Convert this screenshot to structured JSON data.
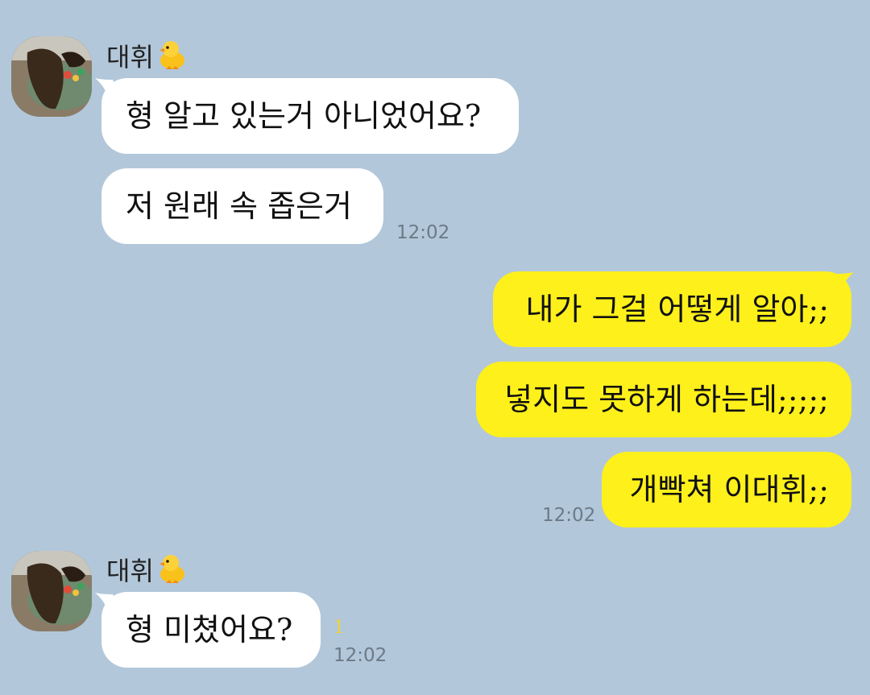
{
  "chat": {
    "groups": [
      {
        "sender_name": "대휘",
        "sender_emoji": "baby-chick-icon",
        "messages": [
          {
            "text": "형 알고 있는거 아니었어요?"
          },
          {
            "text": "저 원래 속 좁은거",
            "time": "12:02"
          }
        ]
      },
      {
        "outgoing": true,
        "messages": [
          {
            "text": "내가 그걸 어떻게 알아;;"
          },
          {
            "text": "넣지도 못하게 하는데;;;;;"
          },
          {
            "text": "개빡쳐 이대휘;;",
            "time": "12:02"
          }
        ]
      },
      {
        "sender_name": "대휘",
        "sender_emoji": "baby-chick-icon",
        "messages": [
          {
            "text": "형 미쳤어요?",
            "unread": "1",
            "time": "12:02"
          }
        ]
      }
    ]
  },
  "colors": {
    "background": "#b2c7da",
    "incoming_bubble": "#ffffff",
    "outgoing_bubble": "#fef01b",
    "timestamp": "#6c7a87",
    "unread_count": "#e9d53a"
  }
}
